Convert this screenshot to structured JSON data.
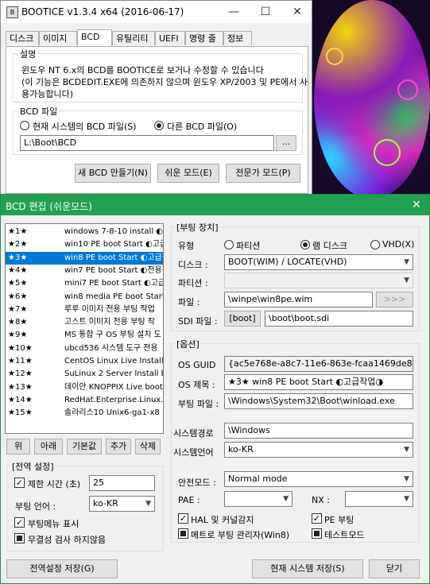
{
  "main_window": {
    "title": "BOOTICE v1.3.4 x64 (2016-06-17)",
    "tabs": [
      "디스크",
      "이미지",
      "BCD",
      "유틸리티",
      "UEFI",
      "명령 줄",
      "정보"
    ],
    "active_tab": "BCD",
    "description": {
      "heading": "설명",
      "line1": "윈도우 NT 6.x의 BCD를 BOOTICE로 보거나 수정할 수 있습니다",
      "line2": "(이 기능은 BCDEDIT.EXE에 의존하지 않으며 윈도우 XP/2003 및 PE에서 사",
      "line3": "용가능합니다)"
    },
    "bcd_file": {
      "heading": "BCD 파일",
      "option_current": "현재 시스템의 BCD 파일(S)",
      "option_other": "다른 BCD 파일(O)",
      "selected": "other",
      "path": "L:\\Boot\\BCD",
      "browse_label": "..."
    },
    "buttons": {
      "new_bcd": "새 BCD 만들기(N)",
      "easy_mode": "쉬운 모드(E)",
      "expert_mode": "전문가 모드(P)"
    }
  },
  "bcd_editor": {
    "title": "BCD 편집 (쉬운모드)",
    "entries": [
      {
        "num": "★1★",
        "name": "windows 7-8-10 install ◐전"
      },
      {
        "num": "★2★",
        "name": "win10 PE boot Start ◐고급"
      },
      {
        "num": "★3★",
        "name": "win8 PE boot Start ◐고급작"
      },
      {
        "num": "★4★",
        "name": "win7 PE boot Start ◐전용작"
      },
      {
        "num": "★5★",
        "name": "mini7 PE boot Start ◐고급"
      },
      {
        "num": "★6★",
        "name": "win8 media PE boot Start"
      },
      {
        "num": "★7★",
        "name": "루루 이미지 전용 부팅 작업"
      },
      {
        "num": "★8★",
        "name": "고스트 이미지 전용 부팅 작"
      },
      {
        "num": "★9★",
        "name": "MS 통합 구 OS 부팅 설치 도"
      },
      {
        "num": "★10★",
        "name": "ubcd536 시스템 도구 전용"
      },
      {
        "num": "★11★",
        "name": "CentOS Linux Live Install l"
      },
      {
        "num": "★12★",
        "name": "SuLinux 2 Server Install b"
      },
      {
        "num": "★13★",
        "name": "데이안 KNOPPIX Live boot"
      },
      {
        "num": "★14★",
        "name": "RedHat.Enterprise.Linux.c"
      },
      {
        "num": "★15★",
        "name": "솔라리스10 Unix6-ga1-x8"
      }
    ],
    "selected_index": 2,
    "list_buttons": {
      "up": "위",
      "down": "아래",
      "default": "기본값",
      "add": "추가",
      "delete": "삭제"
    },
    "global": {
      "heading": "[전역 설정]",
      "timeout_label": "제한 시간 (초)",
      "timeout_checked": true,
      "timeout_value": "25",
      "boot_lang_label": "부팅 언어 :",
      "boot_lang_value": "ko-KR",
      "show_menu_label": "부팅메뉴 표시",
      "show_menu_checked": true,
      "no_integrity_label": "무결성 검사 하지않음"
    },
    "boot_device": {
      "heading": "[부팅 장치]",
      "type_label": "유형",
      "type_partition": "파티션",
      "type_ramdisk": "램 디스크",
      "type_vhd": "VHD(X)",
      "type_selected": "ramdisk",
      "disk_label": "디스크 :",
      "disk_value": "BOOT(WIM) / LOCATE(VHD)",
      "partition_label": "파티션 :",
      "partition_value": "",
      "file_label": "파일 :",
      "file_value": "\\winpe\\win8pe.wim",
      "file_browse": ">>>",
      "sdi_label": "SDI 파일 :",
      "sdi_button": "[boot]",
      "sdi_value": "\\boot\\boot.sdi"
    },
    "options": {
      "heading": "[옵션]",
      "guid_label": "OS GUID",
      "guid_value": "{ac5e768e-a8c7-11e6-863e-fcaa1469de86}",
      "title_label": "OS 제목 :",
      "title_value": "★3★            win8 PE boot Start  ◐고급작업◑",
      "bootfile_label": "부팅 파일 :",
      "bootfile_value": "\\Windows\\System32\\Boot\\winload.exe",
      "syspath_label": "시스템경로",
      "syspath_value": "\\Windows",
      "syslang_label": "시스템언어",
      "syslang_value": "ko-KR",
      "safemode_label": "안전모드 :",
      "safemode_value": "Normal mode",
      "pae_label": "PAE :",
      "pae_value": "",
      "nx_label": "NX :",
      "nx_value": "",
      "hal_label": "HAL 및 커널감지",
      "hal_checked": true,
      "pe_label": "PE 부팅",
      "pe_checked": true,
      "metro_label": "메트로 부팅 관리자(Win8)",
      "test_label": "테스트모드"
    },
    "bottom_buttons": {
      "save_global": "전역설정 저장(G)",
      "save_current": "현재 시스템 저장(S)",
      "close": "닫기"
    }
  }
}
